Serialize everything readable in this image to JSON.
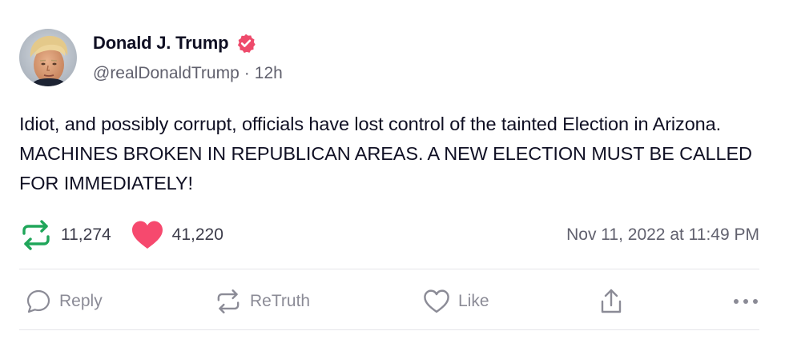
{
  "author": {
    "display_name": "Donald J. Trump",
    "handle": "@realDonaldTrump",
    "separator": "·",
    "relative_time": "12h",
    "verified": true
  },
  "post": {
    "text": "Idiot, and possibly corrupt, officials have lost control of the tainted Election in Arizona. MACHINES BROKEN IN REPUBLICAN AREAS. A NEW ELECTION MUST BE CALLED FOR IMMEDIATELY!"
  },
  "stats": {
    "retruths": "11,274",
    "likes": "41,220",
    "timestamp": "Nov 11, 2022 at 11:49 PM"
  },
  "actions": {
    "reply_label": "Reply",
    "retruth_label": "ReTruth",
    "like_label": "Like"
  },
  "icons": {
    "verified": "verified-badge-icon",
    "retruth_stat": "retruth-icon",
    "like_stat": "heart-icon",
    "reply": "comment-icon",
    "retruth": "retruth-icon",
    "like": "heart-outline-icon",
    "share": "share-icon",
    "more": "more-horizontal-icon"
  },
  "colors": {
    "verified": "#ee4a6b",
    "retruth_stat": "#20a65a",
    "like_stat": "#f6496e",
    "text": "#0f0f23",
    "muted": "#61616e",
    "action": "#8b8b96"
  }
}
